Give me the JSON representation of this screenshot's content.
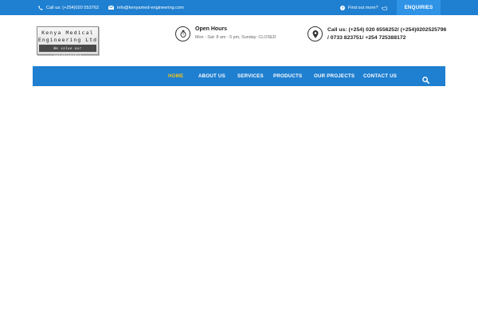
{
  "topbar": {
    "phone": "Call us: (+254)020 553762",
    "email": "info@kenyamed-engineering.com",
    "find_out": "Find out more?",
    "enquiries": "ENQUIRIES"
  },
  "logo": {
    "line1": "Kenya Medical",
    "line2": "Engineering Ltd",
    "tagline": "We value our relationship"
  },
  "hours": {
    "title": "Open Hours",
    "text": "Mon - Sat: 8 am - 5 pm, Sunday: CLOSED"
  },
  "call": {
    "text": "Call us: (+254) 020 6556252/ (+254)0202525796 / 0733 823751/ +254 725388172"
  },
  "nav": {
    "items": [
      "HOME",
      "ABOUT US",
      "SERVICES",
      "PRODUCTS",
      "OUR PROJECTS",
      "CONTACT US"
    ]
  },
  "colors": {
    "primary": "#1f7fd0",
    "active": "#f5c518"
  },
  "icons": {
    "phone": "phone-icon",
    "mail": "envelope-icon",
    "question": "question-circle-icon",
    "hand": "hand-pointer-icon",
    "clock": "clock-icon",
    "location": "map-marker-icon",
    "search": "search-icon"
  }
}
